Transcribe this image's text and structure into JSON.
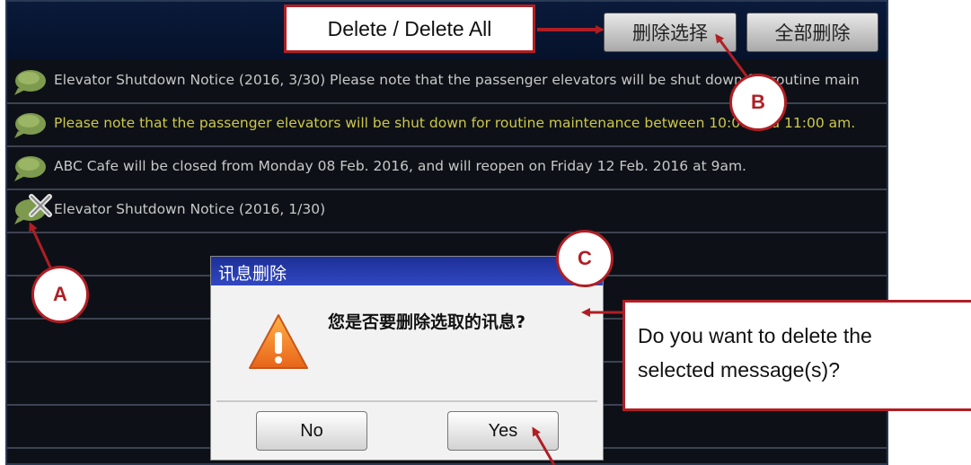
{
  "topbar": {
    "delete_selected_label": "删除选择",
    "delete_all_label": "全部删除"
  },
  "messages": [
    {
      "text": "Elevator Shutdown Notice (2016, 3/30) Please note that the passenger elevators will be shut down for routine main",
      "highlighted": false,
      "selected": false
    },
    {
      "text": "Please note that the passenger elevators will be shut down for routine maintenance between 10:00 and 11:00 am.",
      "highlighted": true,
      "selected": false
    },
    {
      "text": "ABC Cafe will be closed from Monday 08 Feb. 2016, and will reopen on Friday 12 Feb. 2016 at 9am.",
      "highlighted": false,
      "selected": false
    },
    {
      "text": "Elevator Shutdown Notice (2016, 1/30)",
      "highlighted": false,
      "selected": true
    }
  ],
  "dialog": {
    "title": "讯息删除",
    "message": "您是否要删除选取的讯息?",
    "no_label": "No",
    "yes_label": "Yes",
    "icon": "warning-icon"
  },
  "annotations": {
    "delete_caption": "Delete / Delete All",
    "confirm_caption_line1": "Do you want to delete the",
    "confirm_caption_line2": "selected message(s)?",
    "badge_a": "A",
    "badge_b": "B",
    "badge_c": "C"
  },
  "colors": {
    "annotation_red": "#b01e24",
    "highlight_text": "#cfc84a",
    "dialog_title_bar": "#2a3fb5"
  }
}
